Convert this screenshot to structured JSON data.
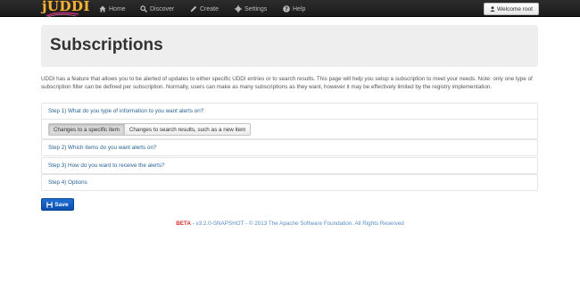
{
  "app": {
    "logo_text": "jUDDI"
  },
  "nav": {
    "items": [
      {
        "label": "Home",
        "icon": "home-icon"
      },
      {
        "label": "Discover",
        "icon": "search-icon"
      },
      {
        "label": "Create",
        "icon": "pencil-icon"
      },
      {
        "label": "Settings",
        "icon": "gear-icon"
      },
      {
        "label": "Help",
        "icon": "question-icon"
      }
    ],
    "welcome_label": "Welcome root"
  },
  "page": {
    "title": "Subscriptions",
    "intro": "UDDI has a feature that allows you to be alerted of updates to either specific UDDI entries or to search results. This page will help you setup a subscription to meet your needs. Note: only one type of subscription filter can be defined per subscription. Normally, users can make as many subscriptions as they want, however it may be effectively limited by the registry implementation."
  },
  "steps": [
    {
      "label": "Step 1) What do you type of information to you want alerts on?"
    },
    {
      "label": "Step 2) Which items do you want alerts on?"
    },
    {
      "label": "Step 3) How do you want to receive the alerts?"
    },
    {
      "label": "Step 4) Options"
    }
  ],
  "step1_options": {
    "specific_item": "Changes to a specific item",
    "search_results": "Changes to search results, such as a new item",
    "selected": "Changes to a specific item"
  },
  "save_label": "Save",
  "footer": {
    "beta": "BETA",
    "text": " - v3.2.0-SNAPSHOT - © 2013 The Apache Software Foundation. All Rights Reserved"
  },
  "colors": {
    "navbar": "#1b1b1b",
    "link": "#2a6496",
    "primary": "#0a4fb0",
    "beta": "#d9302c"
  }
}
